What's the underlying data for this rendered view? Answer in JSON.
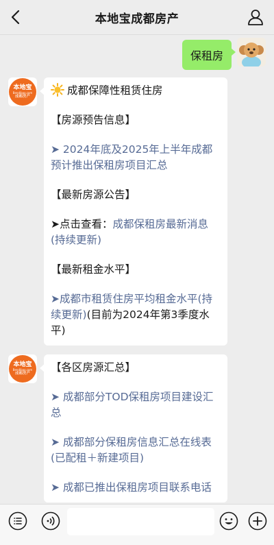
{
  "header": {
    "title": "本地宝成都房产",
    "back_icon": "back-chevron-icon",
    "profile_icon": "user-profile-icon"
  },
  "chat": {
    "my_message": "保租房",
    "bot_logo": {
      "main": "本地宝",
      "url": "Bendibao.com",
      "sub": "成都房产"
    },
    "message1": {
      "title": "成都保障性租赁住房",
      "section1": "【房源预告信息】",
      "link1": "➤ 2024年底及2025年上半年成都预计推出保租房项目汇总",
      "section2": "【最新房源公告】",
      "line2_prefix": "➤点击查看：",
      "link2": "成都保租房最新消息(持续更新)",
      "section3": "【最新租金水平】",
      "link3": "➤成都市租赁住房平均租金水平(持续更新)",
      "line3_suffix": "(目前为2024年第3季度水平)"
    },
    "message2": {
      "section": "【各区房源汇总】",
      "link1": "➤ 成都部分TOD保租房项目建设汇总",
      "link2": "➤ 成都部分保租房信息汇总在线表(已配租＋新建项目)",
      "link3": "➤ 成都已推出保租房项目联系电话"
    }
  },
  "footer": {
    "menu_icon": "menu-list-icon",
    "voice_icon": "voice-icon",
    "emoji_icon": "emoji-icon",
    "plus_icon": "plus-icon",
    "input_value": ""
  },
  "colors": {
    "background": "#ededed",
    "my_bubble": "#95ec69",
    "link": "#576b95",
    "logo": "#ee6b1f"
  }
}
